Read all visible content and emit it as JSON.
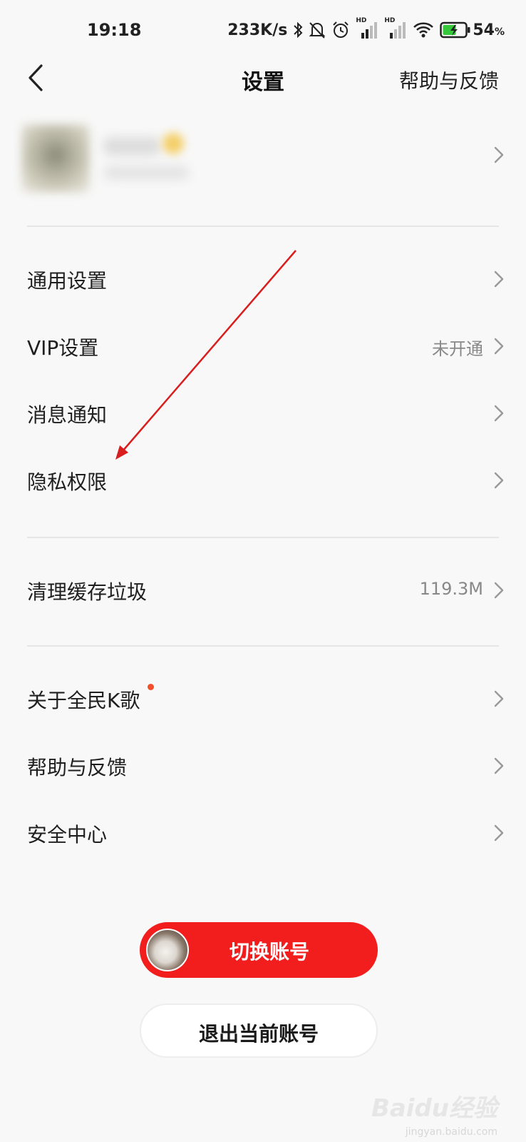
{
  "status_bar": {
    "time": "19:18",
    "net_speed": "233K/s",
    "hd_label": "HD",
    "battery_value": "54",
    "battery_unit": "%"
  },
  "nav": {
    "title": "设置",
    "help_label": "帮助与反馈"
  },
  "menu": {
    "general": {
      "label": "通用设置"
    },
    "vip": {
      "label": "VIP设置",
      "value": "未开通"
    },
    "notify": {
      "label": "消息通知"
    },
    "privacy": {
      "label": "隐私权限"
    },
    "cache": {
      "label": "清理缓存垃圾",
      "value": "119.3M"
    },
    "about": {
      "label": "关于全民K歌"
    },
    "help": {
      "label": "帮助与反馈"
    },
    "security": {
      "label": "安全中心"
    }
  },
  "buttons": {
    "switch_account": "切换账号",
    "logout": "退出当前账号"
  },
  "colors": {
    "accent_red": "#f21e1e",
    "dot_red": "#f2502a",
    "annotation_red": "#d81e1e",
    "battery_green": "#35c83a"
  },
  "watermark": {
    "text": "Baidu经验",
    "sub": "jingyan.baidu.com"
  }
}
